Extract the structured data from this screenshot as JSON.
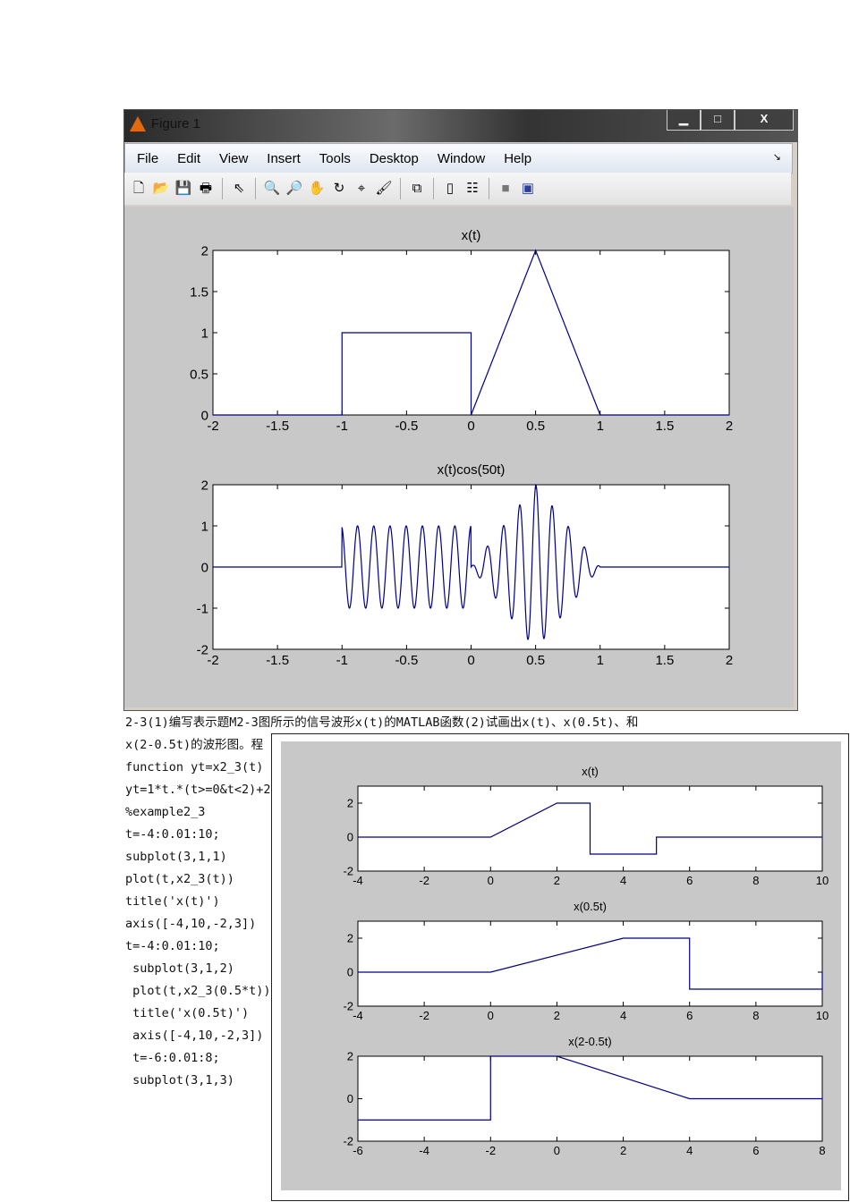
{
  "window": {
    "title": "Figure 1",
    "min": "▁",
    "max": "□",
    "close": "X"
  },
  "menu": [
    "File",
    "Edit",
    "View",
    "Insert",
    "Tools",
    "Desktop",
    "Window",
    "Help"
  ],
  "toolbar_icons": [
    "new-figure-icon",
    "open-file-icon",
    "save-icon",
    "print-icon",
    "pointer-icon",
    "zoom-in-icon",
    "zoom-out-icon",
    "pan-hand-icon",
    "rotate-3d-icon",
    "data-cursor-icon",
    "brush-icon",
    "link-plot-icon",
    "colorbar-icon",
    "legend-icon",
    "hide-plot-tools-icon",
    "show-plot-tools-icon"
  ],
  "doc": {
    "line1": "2-3(1)编写表示题M2-3图所示的信号波形x(t)的MATLAB函数(2)试画出x(t)、x(0.5t)、和",
    "line2": "x(2-0.5t)的波形图。程",
    "code": [
      "function yt=x2_3(t)",
      "yt=1*t.*(t>=0&t<2)+2",
      "%example2_3",
      "t=-4:0.01:10;",
      "subplot(3,1,1)",
      "plot(t,x2_3(t))",
      "title('x(t)')",
      "axis([-4,10,-2,3])",
      "t=-4:0.01:10;",
      " subplot(3,1,2)",
      " plot(t,x2_3(0.5*t))",
      " title('x(0.5t)')",
      " axis([-4,10,-2,3])",
      " t=-6:0.01:8;",
      " subplot(3,1,3)"
    ]
  },
  "chart_data": [
    {
      "type": "line",
      "title": "x(t)",
      "xlim": [
        -2,
        2
      ],
      "ylim": [
        0,
        2
      ],
      "xticks": [
        "-2",
        "-1.5",
        "-1",
        "-0.5",
        "0",
        "0.5",
        "1",
        "1.5",
        "2"
      ],
      "yticks": [
        "0",
        "0.5",
        "1",
        "1.5",
        "2"
      ],
      "x": [
        -2,
        -1,
        -1,
        0,
        0,
        0.5,
        1,
        2
      ],
      "y": [
        0,
        0,
        1,
        1,
        0,
        2,
        0,
        0
      ],
      "color": "#000080"
    },
    {
      "type": "line",
      "title": "x(t)cos(50t)",
      "xlim": [
        -2,
        2
      ],
      "ylim": [
        -2,
        2
      ],
      "xticks": [
        "-2",
        "-1.5",
        "-1",
        "-0.5",
        "0",
        "0.5",
        "1",
        "1.5",
        "2"
      ],
      "yticks": [
        "-2",
        "-1",
        "0",
        "1",
        "2"
      ],
      "envelope_x": [
        -2,
        -1,
        -1,
        0,
        0,
        0.5,
        1,
        2
      ],
      "envelope_y": [
        0,
        0,
        1,
        1,
        0,
        2,
        0,
        0
      ],
      "carrier_rad_per_unit": 50,
      "color": "#000080"
    },
    {
      "type": "line",
      "title": "x(t)",
      "xlim": [
        -4,
        10
      ],
      "ylim": [
        -2,
        3
      ],
      "xticks": [
        "-4",
        "-2",
        "0",
        "2",
        "4",
        "6",
        "8",
        "10"
      ],
      "yticks": [
        "-2",
        "0",
        "2"
      ],
      "x": [
        -4,
        0,
        2,
        3,
        3,
        5,
        5,
        10
      ],
      "y": [
        0,
        0,
        2,
        2,
        -1,
        -1,
        0,
        0
      ],
      "color": "#000080"
    },
    {
      "type": "line",
      "title": "x(0.5t)",
      "xlim": [
        -4,
        10
      ],
      "ylim": [
        -2,
        3
      ],
      "xticks": [
        "-4",
        "-2",
        "0",
        "2",
        "4",
        "6",
        "8",
        "10"
      ],
      "yticks": [
        "-2",
        "0",
        "2"
      ],
      "x": [
        -4,
        0,
        4,
        6,
        6,
        10,
        10
      ],
      "y": [
        0,
        0,
        2,
        2,
        -1,
        -1,
        0
      ],
      "color": "#000080"
    },
    {
      "type": "line",
      "title": "x(2-0.5t)",
      "xlim": [
        -6,
        8
      ],
      "ylim": [
        -2,
        2
      ],
      "xticks": [
        "-6",
        "-4",
        "-2",
        "0",
        "2",
        "4",
        "6",
        "8"
      ],
      "yticks": [
        "-2",
        "0",
        "2"
      ],
      "x": [
        -6,
        -2,
        -2,
        0,
        4,
        8
      ],
      "y": [
        -1,
        -1,
        2,
        2,
        0,
        0
      ],
      "color": "#000080"
    }
  ]
}
